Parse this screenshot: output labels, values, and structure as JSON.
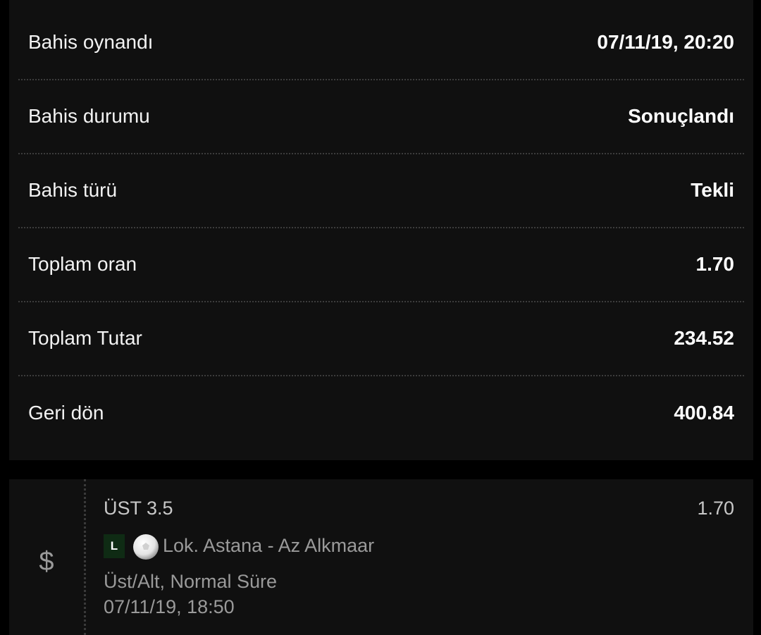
{
  "summary": {
    "rows": [
      {
        "label": "Bahis oynandı",
        "value": "07/11/19, 20:20"
      },
      {
        "label": "Bahis durumu",
        "value": "Sonuçlandı"
      },
      {
        "label": "Bahis türü",
        "value": "Tekli"
      },
      {
        "label": "Toplam oran",
        "value": "1.70"
      },
      {
        "label": "Toplam Tutar",
        "value": "234.52"
      },
      {
        "label": "Geri dön",
        "value": "400.84"
      }
    ]
  },
  "selection": {
    "icon": "dollar-icon",
    "icon_glyph": "$",
    "pick": "ÜST 3.5",
    "odds": "1.70",
    "live_badge": "L",
    "sport_icon": "soccer-ball-icon",
    "match": "Lok. Astana - Az Alkmaar",
    "market": "Üst/Alt, Normal Süre",
    "event_time": "07/11/19, 18:50"
  },
  "colors": {
    "background": "#000000",
    "card": "#101010",
    "live_badge_bg": "#0f2b14",
    "muted_text": "#9a9a9a"
  }
}
